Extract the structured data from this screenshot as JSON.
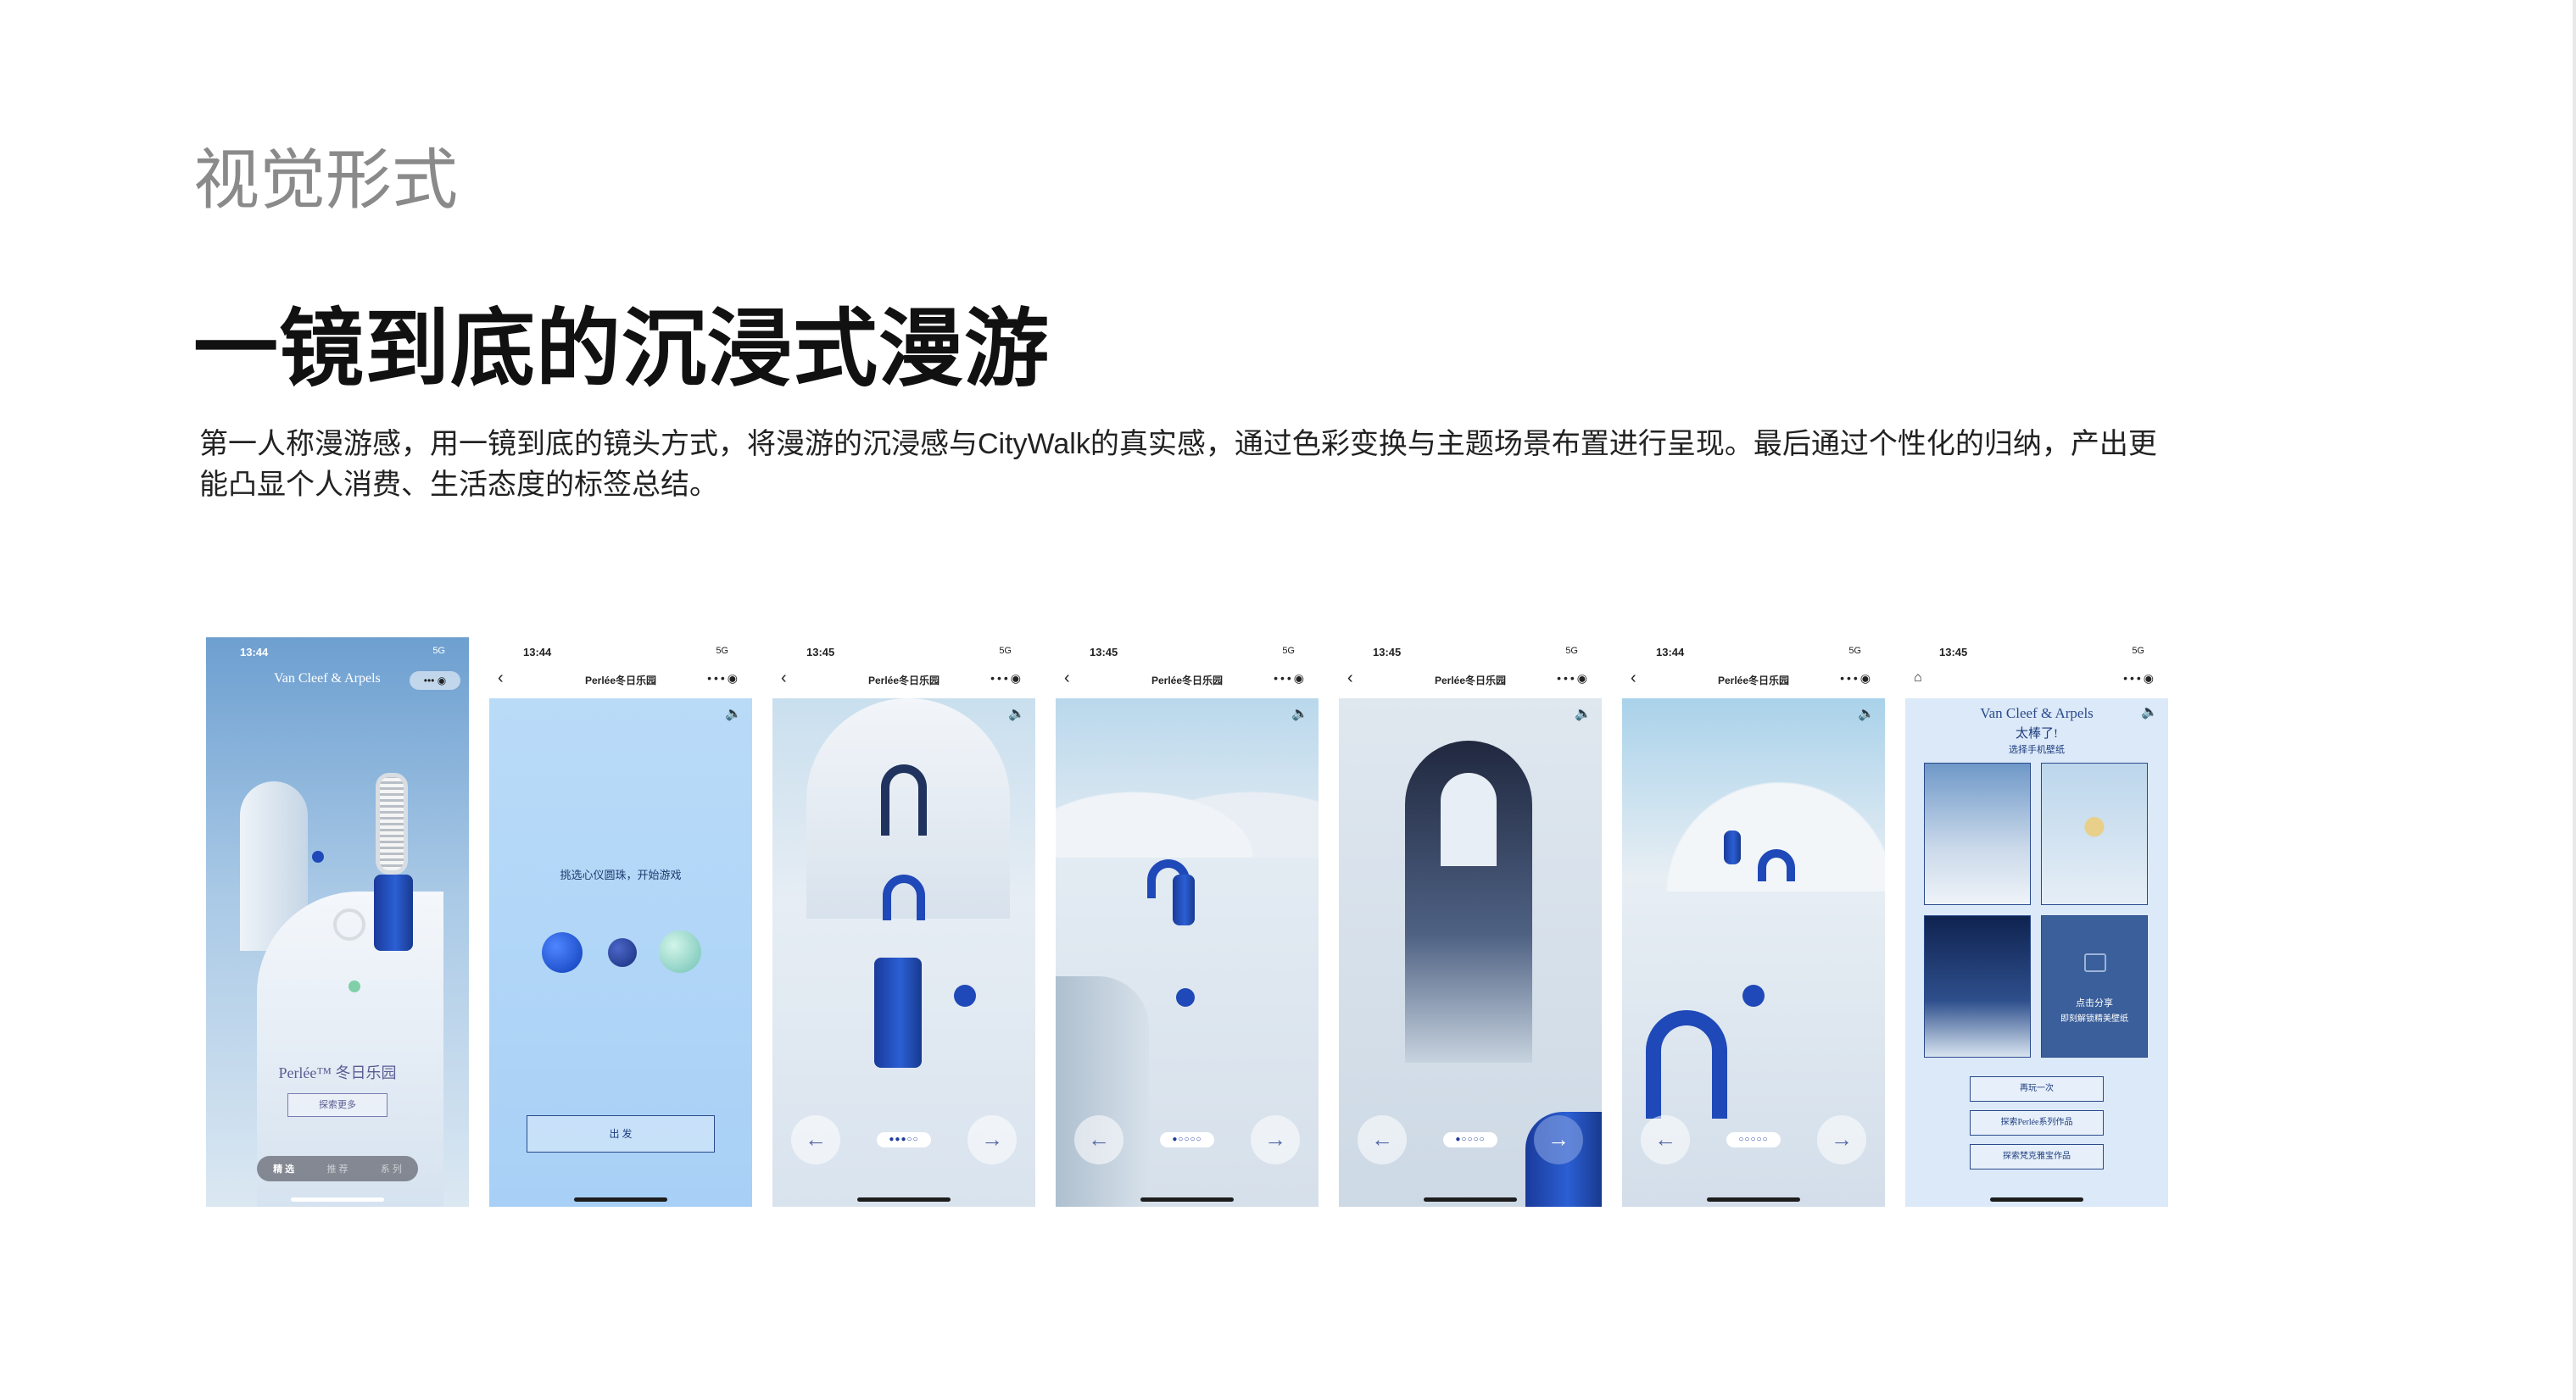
{
  "section_label": "视觉形式",
  "headline": "一镜到底的沉浸式漫游",
  "description": "第一人称漫游感，用一镜到底的镜头方式，将漫游的沉浸感与CityWalk的真实感，通过色彩变换与主题场景布置进行呈现。最后通过个性化的归纳，产出更能凸显个人消费、生活态度的标签总结。",
  "colors": {
    "accent_blue": "#1f49b8",
    "sky": "#cfe4f6",
    "snow": "#e8eef6"
  },
  "icons": [
    "chevron-left-icon",
    "more-icon",
    "target-icon",
    "sound-icon",
    "arrow-left-icon",
    "arrow-right-icon",
    "home-icon",
    "lock-icon"
  ],
  "phones": [
    {
      "time": "13:44",
      "signal": "5G",
      "brand": "Van Cleef & Arpels",
      "title": "Perlée™ 冬日乐园",
      "button": "探索更多",
      "tabs": [
        "精 选",
        "推 荐",
        "系 列"
      ]
    },
    {
      "time": "13:44",
      "signal": "5G",
      "nav_title": "Perlée冬日乐园",
      "prompt": "挑选心仪圆珠，开始游戏",
      "button": "出 发"
    },
    {
      "time": "13:45",
      "signal": "5G",
      "nav_title": "Perlée冬日乐园",
      "pager": "●●●○○"
    },
    {
      "time": "13:45",
      "signal": "5G",
      "nav_title": "Perlée冬日乐园",
      "pager": "●○○○○"
    },
    {
      "time": "13:45",
      "signal": "5G",
      "nav_title": "Perlée冬日乐园",
      "pager": "●○○○○"
    },
    {
      "time": "13:44",
      "signal": "5G",
      "nav_title": "Perlée冬日乐园",
      "pager": "○○○○○"
    },
    {
      "time": "13:45",
      "signal": "5G",
      "brand": "Van Cleef & Arpels",
      "great": "太棒了!",
      "choose": "选择手机壁纸",
      "unlock": "点击分享",
      "unlock2": "即刻解锁精美壁纸",
      "buttons": [
        "再玩一次",
        "探索Perlée系列作品",
        "探索梵克雅宝作品"
      ]
    }
  ]
}
